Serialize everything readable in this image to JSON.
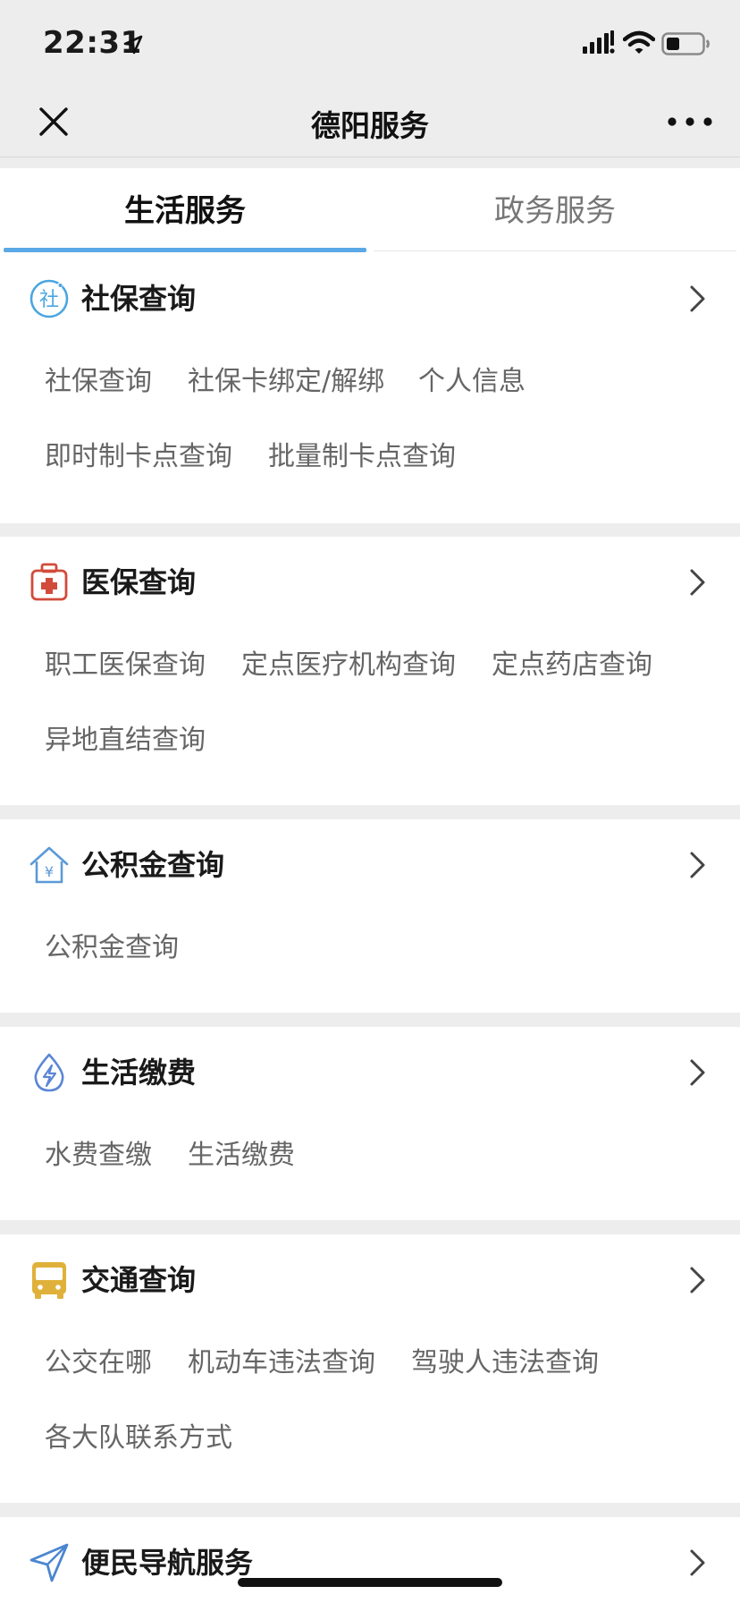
{
  "status": {
    "time": "22:31"
  },
  "nav": {
    "title": "德阳服务"
  },
  "tabs": [
    {
      "label": "生活服务",
      "active": true
    },
    {
      "label": "政务服务",
      "active": false
    }
  ],
  "sections": [
    {
      "title": "社保查询",
      "icon": "social-security-icon",
      "items": [
        "社保查询",
        "社保卡绑定/解绑",
        "个人信息",
        "即时制卡点查询",
        "批量制卡点查询"
      ]
    },
    {
      "title": "医保查询",
      "icon": "medical-kit-icon",
      "items": [
        "职工医保查询",
        "定点医疗机构查询",
        "定点药店查询",
        "异地直结查询"
      ]
    },
    {
      "title": "公积金查询",
      "icon": "house-fund-icon",
      "items": [
        "公积金查询"
      ]
    },
    {
      "title": "生活缴费",
      "icon": "water-drop-icon",
      "items": [
        "水费查缴",
        "生活缴费"
      ]
    },
    {
      "title": "交通查询",
      "icon": "bus-icon",
      "items": [
        "公交在哪",
        "机动车违法查询",
        "驾驶人违法查询",
        "各大队联系方式"
      ]
    },
    {
      "title": "便民导航服务",
      "icon": "navigation-icon",
      "items": []
    }
  ],
  "colors": {
    "tab_accent": "#5aa9e6",
    "social_icon": "#4aa6e0",
    "medical_icon": "#d24b3a",
    "fund_icon": "#5b9ad8",
    "water_icon": "#5b86d6",
    "bus_icon": "#e0b13a",
    "nav_icon": "#4a86d0"
  }
}
